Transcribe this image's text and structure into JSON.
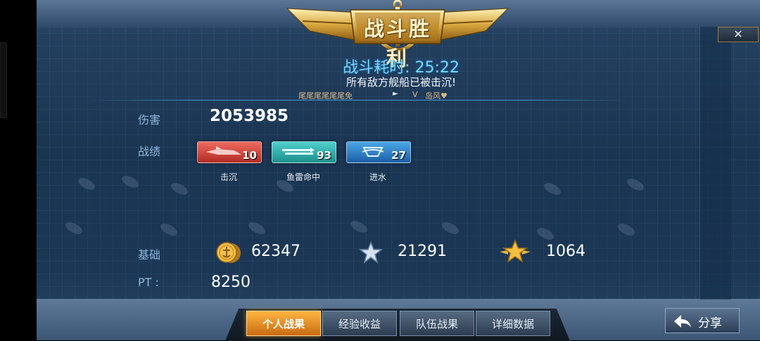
{
  "header": {
    "title": "战斗胜利",
    "duration_label": "战斗耗时:",
    "duration_value": "25:22",
    "subtitle": "所有敌方舰船已被击沉!",
    "player_left": "尾尾尾尾尾尾免",
    "versus": "V",
    "player_right": "岛风♥"
  },
  "stats": {
    "damage_label": "伤害",
    "damage_value": "2053985",
    "record_label": "战绩",
    "badges": [
      {
        "icon": "sunk-ship-icon",
        "count": "10",
        "caption": "击沉",
        "color": "#d8403a"
      },
      {
        "icon": "torpedo-hit-icon",
        "count": "93",
        "caption": "鱼雷命中",
        "color": "#2aa8a8"
      },
      {
        "icon": "flooding-icon",
        "count": "27",
        "caption": "进水",
        "color": "#2a7fc4"
      }
    ],
    "base_label": "基础",
    "coin_value": "62347",
    "silver_star_value": "21291",
    "gold_star_value": "1064",
    "pt_label": "PT :",
    "pt_value": "8250"
  },
  "tabs": [
    "个人战果",
    "经验收益",
    "队伍战果",
    "详细数据"
  ],
  "active_tab": 0,
  "share_label": "分享",
  "close_label": "✕"
}
